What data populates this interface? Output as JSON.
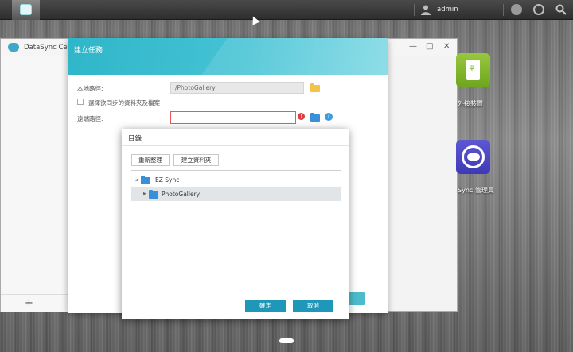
{
  "topbar": {
    "user_name": "admin",
    "app_icon": "cloud-sync-icon",
    "icons": [
      "user-icon",
      "notification-icon",
      "dashboard-icon",
      "search-icon"
    ]
  },
  "background_window": {
    "title": "DataSync Cente",
    "controls": [
      "—",
      "□",
      "✕"
    ],
    "add_label": "+"
  },
  "task_dialog": {
    "title": "建立任務",
    "local_path_label": "本地路徑:",
    "local_path_value": "/PhotoGallery",
    "checkbox_label": "選擇欲同步的資料夾及檔案",
    "remote_path_label": "遠端路徑:",
    "remote_path_value": "",
    "error_glyph": "!",
    "info_glyph": "i"
  },
  "desktop": {
    "icons": [
      {
        "label": "外接裝置",
        "icon": "usb-drive-icon"
      },
      {
        "label": "Sync 管理員",
        "icon": "sync-manager-icon"
      }
    ]
  },
  "dir_dialog": {
    "title": "目錄",
    "refresh_label": "重新整理",
    "new_folder_label": "建立資料夾",
    "tree": [
      {
        "label": "EZ Sync",
        "expanded": true,
        "selected": false
      },
      {
        "label": "PhotoGallery",
        "expanded": false,
        "selected": true
      }
    ],
    "ok_label": "確定",
    "cancel_label": "取消"
  },
  "colors": {
    "accent": "#1f97b8",
    "header_teal": "#2fb6c9",
    "error": "#e23b3b",
    "folder_blue": "#3a8fd8",
    "folder_yellow": "#f5c34a"
  }
}
